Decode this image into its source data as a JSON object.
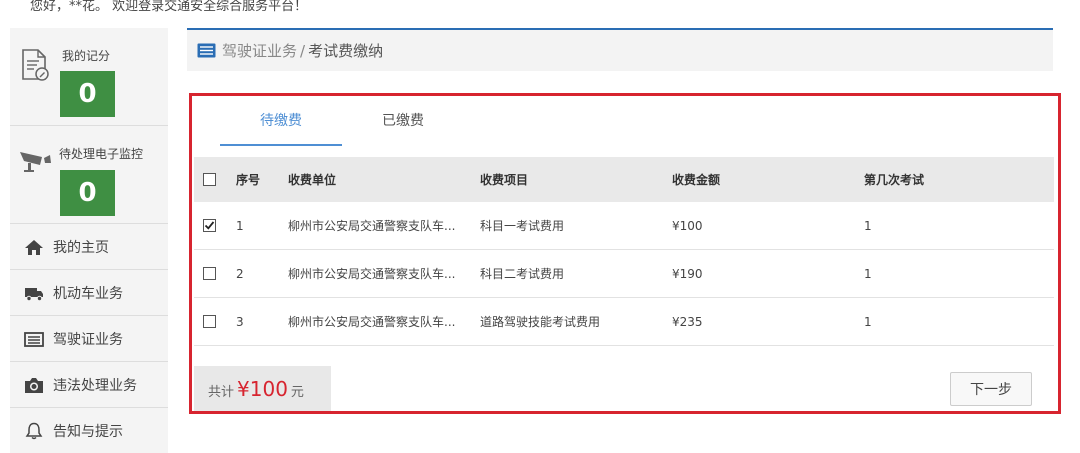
{
  "greeting": "您好，**花。 欢迎登录交通安全综合服务平台！",
  "sidebar": {
    "points_card": {
      "label": "我的记分",
      "count": "0",
      "icon": "score-document-icon"
    },
    "violations_card": {
      "label": "待处理电子监控",
      "count": "0",
      "icon": "surveillance-camera-icon"
    },
    "items": [
      {
        "label": "我的主页",
        "icon": "home-icon"
      },
      {
        "label": "机动车业务",
        "icon": "truck-icon"
      },
      {
        "label": "驾驶证业务",
        "icon": "license-card-icon"
      },
      {
        "label": "违法处理业务",
        "icon": "camera-icon"
      },
      {
        "label": "告知与提示",
        "icon": "bell-icon"
      }
    ]
  },
  "breadcrumb": {
    "parent": "驾驶证业务",
    "separator": "/",
    "current": "考试费缴纳",
    "icon": "list-icon"
  },
  "tabs": [
    {
      "label": "待缴费",
      "active": true
    },
    {
      "label": "已缴费",
      "active": false
    }
  ],
  "table": {
    "headers": [
      "序号",
      "收费单位",
      "收费项目",
      "收费金额",
      "第几次考试"
    ],
    "rows": [
      {
        "checked": true,
        "no": "1",
        "unit": "柳州市公安局交通警察支队车...",
        "item": "科目一考试费用",
        "amount": "¥100",
        "attempt": "1"
      },
      {
        "checked": false,
        "no": "2",
        "unit": "柳州市公安局交通警察支队车...",
        "item": "科目二考试费用",
        "amount": "¥190",
        "attempt": "1"
      },
      {
        "checked": false,
        "no": "3",
        "unit": "柳州市公安局交通警察支队车...",
        "item": "道路驾驶技能考试费用",
        "amount": "¥235",
        "attempt": "1"
      }
    ]
  },
  "footer": {
    "total_label": "共计",
    "total_amount": "¥100",
    "unit": "元",
    "next_label": "下一步"
  },
  "colors": {
    "accent_blue": "#4f8fd4",
    "highlight_red": "#d7242f",
    "count_green": "#3f8f43",
    "breadcrumb_border": "#2a6db4"
  }
}
